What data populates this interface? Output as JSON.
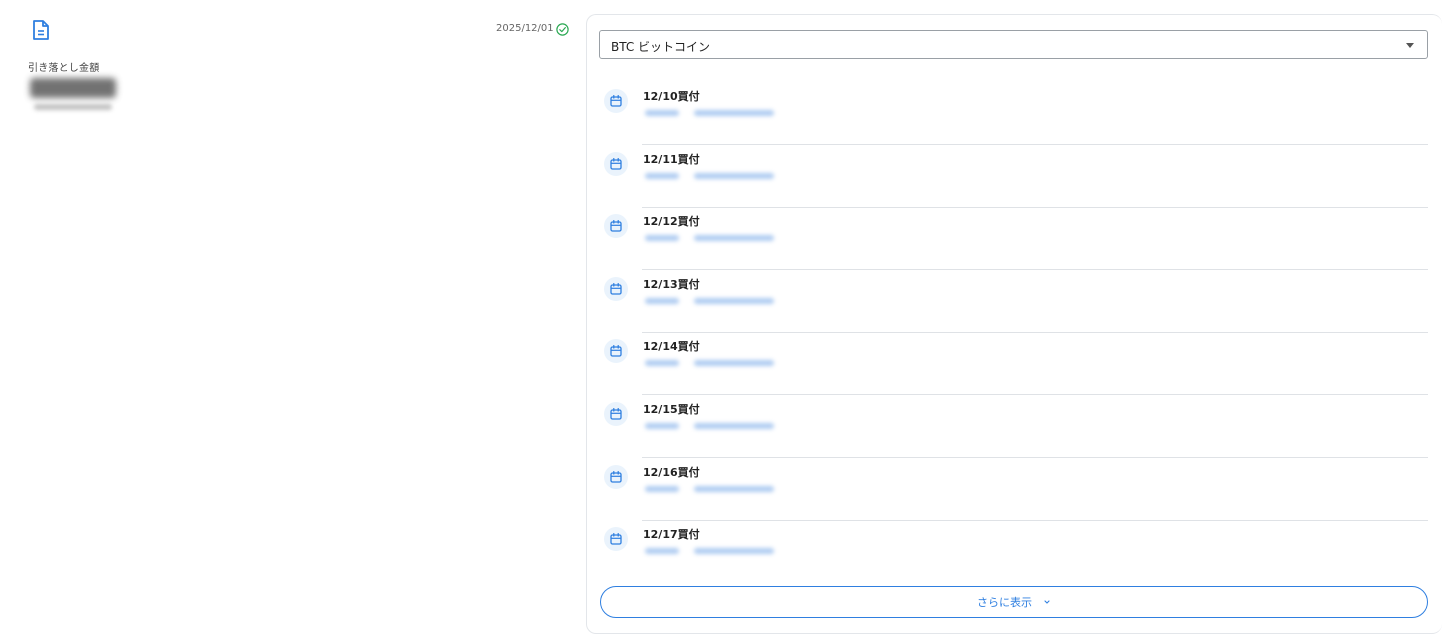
{
  "summary": {
    "icon": "document-icon",
    "label": "引き落とし金額",
    "date": "2025/12/01",
    "status_icon": "check-circle-icon"
  },
  "selector": {
    "value": "BTC ビットコイン"
  },
  "items": [
    {
      "title": "12/10買付"
    },
    {
      "title": "12/11買付"
    },
    {
      "title": "12/12買付"
    },
    {
      "title": "12/13買付"
    },
    {
      "title": "12/14買付"
    },
    {
      "title": "12/15買付"
    },
    {
      "title": "12/16買付"
    },
    {
      "title": "12/17買付"
    }
  ],
  "more": {
    "label": "さらに表示"
  },
  "colors": {
    "accent": "#2f7fe0",
    "success": "#2aa852",
    "icon_bg": "#eaf3fc"
  }
}
